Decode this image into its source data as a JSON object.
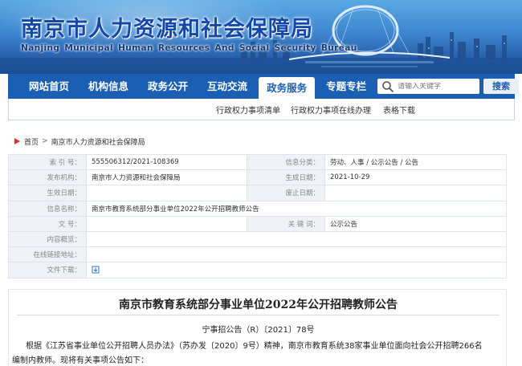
{
  "banner": {
    "title": "南京市人力资源和社会保障局",
    "subtitle": "Nanjing Municipal Human Resources And Social Security Bureau"
  },
  "nav": {
    "items": [
      {
        "label": "网站首页",
        "active": false
      },
      {
        "label": "机构信息",
        "active": false
      },
      {
        "label": "政务公开",
        "active": false
      },
      {
        "label": "互动交流",
        "active": false
      },
      {
        "label": "政务服务",
        "active": true
      },
      {
        "label": "专题专栏",
        "active": false
      }
    ],
    "search_placeholder": "请输入关键字",
    "search_button": "搜索"
  },
  "subnav": {
    "items": [
      "行政权力事项清单",
      "行政权力事项在线办理",
      "表格下载"
    ]
  },
  "breadcrumb": {
    "home": "首页",
    "current": "南京市人力资源和社会保障局"
  },
  "info": {
    "index_label": "索  引  号：",
    "index_value": "555506312/2021-108369",
    "category_label": "信息分类：",
    "category_value": "劳动、人事 / 公示公告 / 公告",
    "publisher_label": "发布机构：",
    "publisher_value": "南京市人力资源和社会保障局",
    "created_label": "生成日期：",
    "created_value": "2021-10-29",
    "valid_label": "生效日期：",
    "valid_value": "",
    "expire_label": "废止日期：",
    "expire_value": "",
    "name_label": "信息名称：",
    "name_value": "南京市教育系统部分事业单位2022年公开招聘教师公告",
    "docno_label": "文      号：",
    "docno_value": "",
    "keywords_label": "关  键  词：",
    "keywords_value": "公示公告",
    "overview_label": "内容概览：",
    "overview_value": "",
    "online_label": "在线链接地址：",
    "online_value": "",
    "download_label": "文件下载："
  },
  "article": {
    "title": "南京市教育系统部分事业单位2022年公开招聘教师公告",
    "doc_no": "宁事招公告（R）〔2021〕78号",
    "line1": "根据《江苏省事业单位公开招聘人员办法》（苏办发〔2020〕9号）精神，南京市教育系统38家事业单位面向社会公开招聘266名",
    "line2": "编制内教师。现将有关事项公告如下："
  },
  "colors": {
    "nav_bg": "#1b5fb4",
    "banner_title": "#1448a8",
    "label_bg": "#eef1f6"
  }
}
